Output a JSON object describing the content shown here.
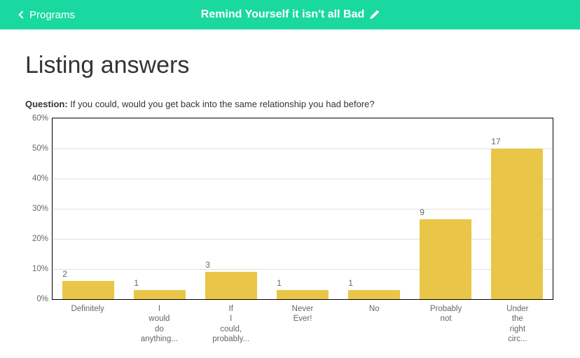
{
  "header": {
    "back_label": "Programs",
    "title": "Remind Yourself it isn't all Bad"
  },
  "page": {
    "heading": "Listing answers",
    "question_prefix": "Question:",
    "question_text": "If you could, would you get back into the same relationship you had before?"
  },
  "chart_data": {
    "type": "bar",
    "title": "",
    "xlabel": "",
    "ylabel": "",
    "ylim": [
      0,
      60
    ],
    "yticks": [
      "0%",
      "10%",
      "20%",
      "30%",
      "40%",
      "50%",
      "60%"
    ],
    "categories": [
      "Definitely",
      "I would do anything...",
      "If I could, probably...",
      "Never Ever!",
      "No",
      "Probably not",
      "Under the right circ..."
    ],
    "values": [
      2,
      1,
      3,
      1,
      1,
      9,
      17
    ],
    "percentages": [
      6,
      3,
      9,
      3,
      3,
      26.5,
      50
    ],
    "bar_color": "#e9c648"
  }
}
